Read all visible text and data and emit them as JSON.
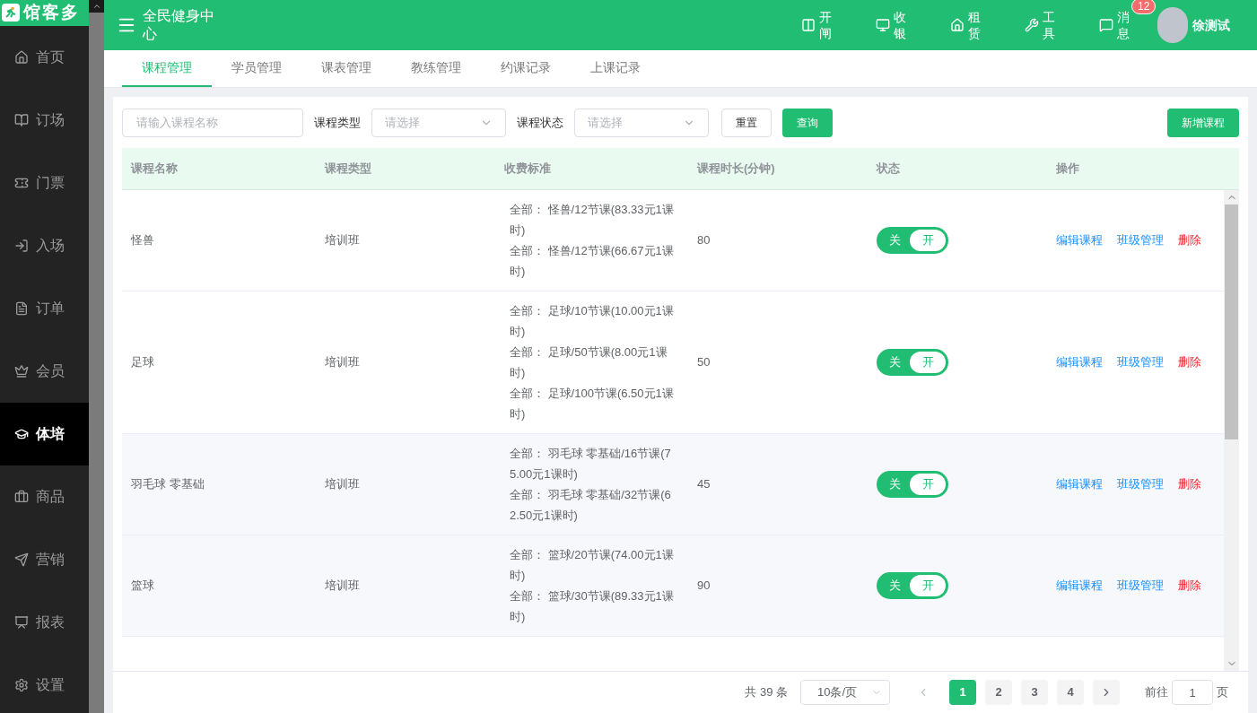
{
  "brand": {
    "name": "馆客多"
  },
  "header": {
    "venue": "全民健身中心",
    "tools": [
      {
        "kind": "gate",
        "label": "开闸"
      },
      {
        "kind": "cashier",
        "label": "收银"
      },
      {
        "kind": "rent",
        "label": "租赁"
      },
      {
        "kind": "tools",
        "label": "工具"
      },
      {
        "kind": "message",
        "label": "消息",
        "badge": "12"
      }
    ],
    "user": {
      "name": "徐测试"
    }
  },
  "sidebar": {
    "items": [
      {
        "kind": "home",
        "label": "首页",
        "selected": false
      },
      {
        "kind": "booking",
        "label": "订场",
        "selected": false
      },
      {
        "kind": "ticket",
        "label": "门票",
        "selected": false
      },
      {
        "kind": "entry",
        "label": "入场",
        "selected": false
      },
      {
        "kind": "order",
        "label": "订单",
        "selected": false
      },
      {
        "kind": "member",
        "label": "会员",
        "selected": false
      },
      {
        "kind": "training",
        "label": "体培",
        "selected": true
      },
      {
        "kind": "goods",
        "label": "商品",
        "selected": false
      },
      {
        "kind": "marketing",
        "label": "营销",
        "selected": false
      },
      {
        "kind": "report",
        "label": "报表",
        "selected": false
      },
      {
        "kind": "settings",
        "label": "设置",
        "selected": false
      }
    ]
  },
  "tabs": [
    {
      "label": "课程管理",
      "selected": true
    },
    {
      "label": "学员管理",
      "selected": false
    },
    {
      "label": "课表管理",
      "selected": false
    },
    {
      "label": "教练管理",
      "selected": false
    },
    {
      "label": "约课记录",
      "selected": false
    },
    {
      "label": "上课记录",
      "selected": false
    }
  ],
  "filters": {
    "name": {
      "placeholder": "请输入课程名称"
    },
    "type": {
      "label": "课程类型",
      "placeholder": "请选择"
    },
    "status": {
      "label": "课程状态",
      "placeholder": "请选择"
    },
    "reset": "重置",
    "query": "查询",
    "add": "新增课程"
  },
  "table": {
    "columns": [
      "课程名称",
      "课程类型",
      "收费标准",
      "课程时长(分钟)",
      "状态",
      "操作"
    ],
    "rows": [
      {
        "name": "怪兽",
        "type": "培训班",
        "fees": [
          "全部： 怪兽/12节课(83.33元1课时)",
          "全部： 怪兽/12节课(66.67元1课时)"
        ],
        "duration": "80",
        "on": true,
        "off_label": "关",
        "on_label": "开",
        "actions": [
          "编辑课程",
          "班级管理",
          "删除"
        ]
      },
      {
        "name": "足球",
        "type": "培训班",
        "fees": [
          "全部： 足球/10节课(10.00元1课时)",
          "全部： 足球/50节课(8.00元1课时)",
          "全部： 足球/100节课(6.50元1课时)"
        ],
        "duration": "50",
        "on": true,
        "off_label": "关",
        "on_label": "开",
        "actions": [
          "编辑课程",
          "班级管理",
          "删除"
        ]
      },
      {
        "name": "羽毛球 零基础",
        "type": "培训班",
        "fees": [
          "全部： 羽毛球 零基础/16节课(75.00元1课时)",
          "全部： 羽毛球 零基础/32节课(62.50元1课时)"
        ],
        "duration": "45",
        "on": true,
        "off_label": "关",
        "on_label": "开",
        "actions": [
          "编辑课程",
          "班级管理",
          "删除"
        ]
      },
      {
        "name": "篮球",
        "type": "培训班",
        "fees": [
          "全部： 篮球/20节课(74.00元1课时)",
          "全部： 篮球/30节课(89.33元1课时)"
        ],
        "duration": "90",
        "on": true,
        "off_label": "关",
        "on_label": "开",
        "actions": [
          "编辑课程",
          "班级管理",
          "删除"
        ]
      }
    ]
  },
  "pagination": {
    "total": "共 39 条",
    "page_size": "10条/页",
    "pages": [
      {
        "label": "1",
        "selected": true
      },
      {
        "label": "2",
        "selected": false
      },
      {
        "label": "3",
        "selected": false
      },
      {
        "label": "4",
        "selected": false
      }
    ],
    "goto_label": "前往",
    "goto_value": "1",
    "goto_suffix": "页"
  }
}
